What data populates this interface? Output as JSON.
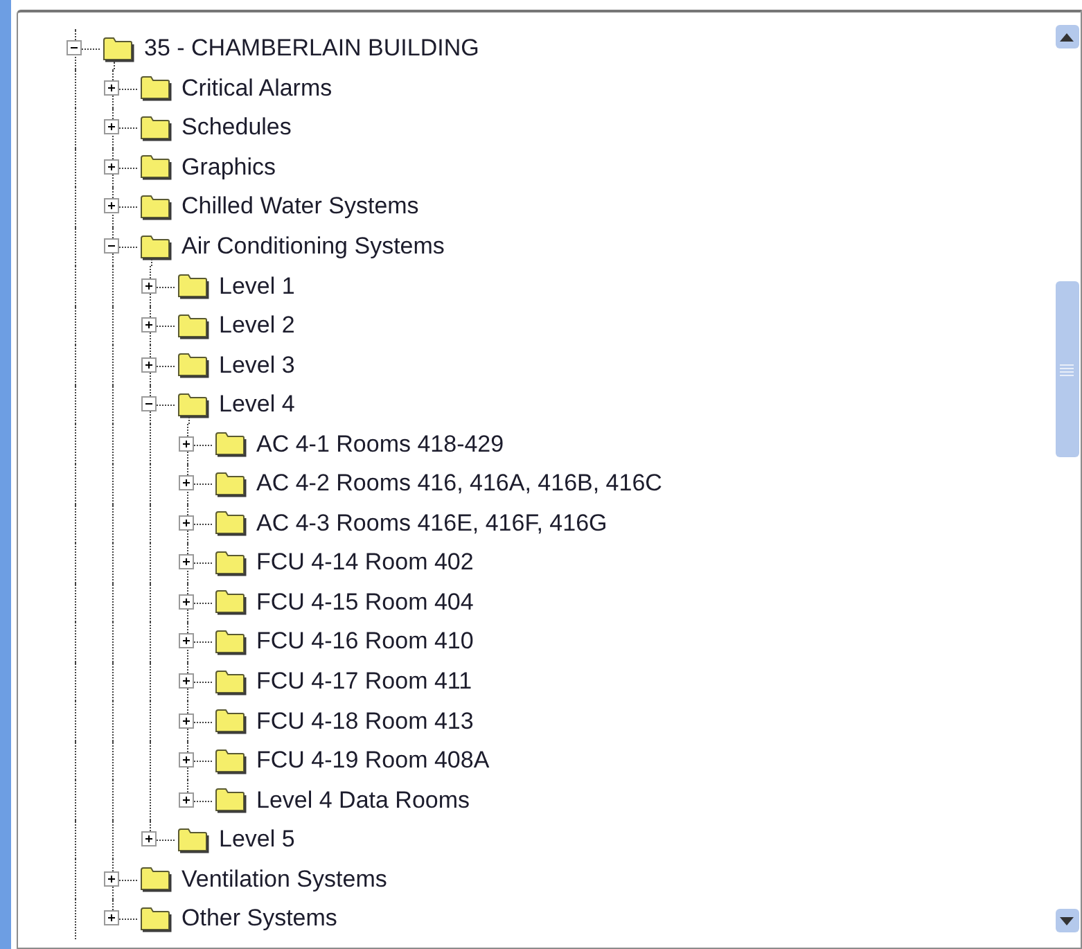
{
  "tree": [
    {
      "label": "35 - CHAMBERLAIN BUILDING",
      "expanded": true,
      "children": [
        {
          "label": "Critical Alarms",
          "expanded": false
        },
        {
          "label": "Schedules",
          "expanded": false
        },
        {
          "label": "Graphics",
          "expanded": false
        },
        {
          "label": "Chilled Water Systems",
          "expanded": false
        },
        {
          "label": "Air Conditioning Systems",
          "expanded": true,
          "children": [
            {
              "label": "Level 1",
              "expanded": false
            },
            {
              "label": "Level 2",
              "expanded": false
            },
            {
              "label": "Level 3",
              "expanded": false
            },
            {
              "label": "Level 4",
              "expanded": true,
              "children": [
                {
                  "label": "AC 4-1 Rooms 418-429",
                  "expanded": false
                },
                {
                  "label": "AC 4-2 Rooms 416, 416A, 416B, 416C",
                  "expanded": false
                },
                {
                  "label": "AC 4-3 Rooms 416E, 416F, 416G",
                  "expanded": false
                },
                {
                  "label": "FCU 4-14 Room 402",
                  "expanded": false
                },
                {
                  "label": "FCU 4-15 Room 404",
                  "expanded": false
                },
                {
                  "label": "FCU 4-16 Room 410",
                  "expanded": false
                },
                {
                  "label": "FCU 4-17 Room 411",
                  "expanded": false
                },
                {
                  "label": "FCU 4-18 Room 413",
                  "expanded": false
                },
                {
                  "label": "FCU 4-19 Room 408A",
                  "expanded": false
                },
                {
                  "label": "Level 4 Data Rooms",
                  "expanded": false
                }
              ]
            },
            {
              "label": "Level 5",
              "expanded": false
            }
          ]
        },
        {
          "label": "Ventilation Systems",
          "expanded": false
        },
        {
          "label": "Other Systems",
          "expanded": false
        }
      ]
    }
  ]
}
